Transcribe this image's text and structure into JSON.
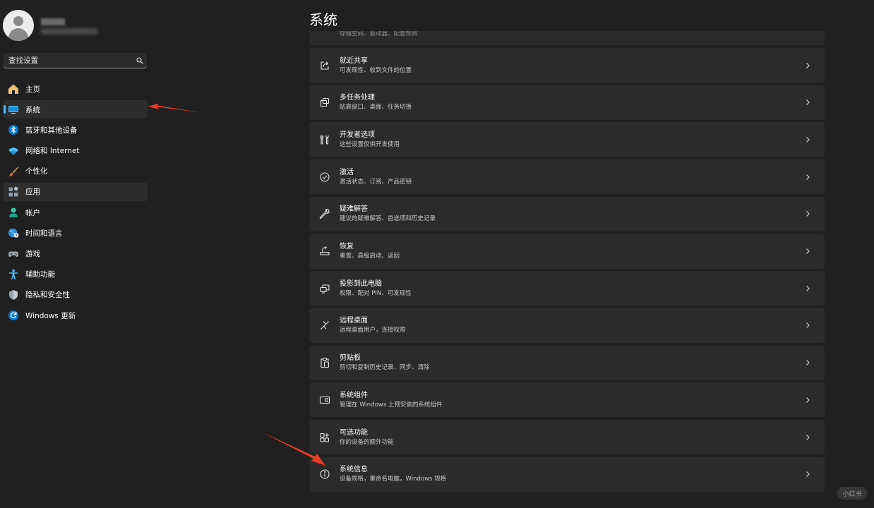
{
  "sidebar": {
    "search": {
      "placeholder": "查找设置"
    },
    "items": [
      {
        "label": "主页",
        "icon": "home-icon"
      },
      {
        "label": "系统",
        "icon": "system-icon",
        "active": true
      },
      {
        "label": "蓝牙和其他设备",
        "icon": "bluetooth-icon"
      },
      {
        "label": "网络和 Internet",
        "icon": "wifi-icon"
      },
      {
        "label": "个性化",
        "icon": "brush-icon"
      },
      {
        "label": "应用",
        "icon": "apps-icon"
      },
      {
        "label": "帐户",
        "icon": "account-icon"
      },
      {
        "label": "时间和语言",
        "icon": "time-language-icon"
      },
      {
        "label": "游戏",
        "icon": "gamepad-icon"
      },
      {
        "label": "辅助功能",
        "icon": "accessibility-icon"
      },
      {
        "label": "隐私和安全性",
        "icon": "shield-icon"
      },
      {
        "label": "Windows 更新",
        "icon": "update-icon"
      }
    ]
  },
  "main": {
    "title": "系统",
    "clipped_item_subtitle": "存储空间、驱动器、配置规则",
    "items": [
      {
        "title": "就近共享",
        "subtitle": "可发现性、收到文件的位置",
        "icon": "share-icon"
      },
      {
        "title": "多任务处理",
        "subtitle": "贴靠窗口、桌面、任务切换",
        "icon": "multitask-icon"
      },
      {
        "title": "开发者选项",
        "subtitle": "这些设置仅供开发使用",
        "icon": "developer-icon"
      },
      {
        "title": "激活",
        "subtitle": "激活状态、订阅、产品密钥",
        "icon": "activation-check-icon"
      },
      {
        "title": "疑难解答",
        "subtitle": "建议的疑难解答、首选项和历史记录",
        "icon": "wrench-icon"
      },
      {
        "title": "恢复",
        "subtitle": "重置、高级启动、返回",
        "icon": "recovery-icon"
      },
      {
        "title": "投影到此电脑",
        "subtitle": "权限、配对 PIN、可发现性",
        "icon": "project-icon"
      },
      {
        "title": "远程桌面",
        "subtitle": "远程桌面用户，连接权限",
        "icon": "remote-desktop-icon"
      },
      {
        "title": "剪贴板",
        "subtitle": "剪切和复制历史记录、同步、清除",
        "icon": "clipboard-icon"
      },
      {
        "title": "系统组件",
        "subtitle": "管理在 Windows 上预安装的系统组件",
        "icon": "system-components-icon"
      },
      {
        "title": "可选功能",
        "subtitle": "你的设备的额外功能",
        "icon": "optional-features-icon"
      },
      {
        "title": "系统信息",
        "subtitle": "设备规格，重命名电脑，Windows 规格",
        "icon": "info-icon"
      }
    ]
  },
  "watermark": "小红书",
  "colors": {
    "background": "#202020",
    "card": "#2b2b2b",
    "accent": "#4cc2ff",
    "annotation_arrow": "#e83a26"
  }
}
